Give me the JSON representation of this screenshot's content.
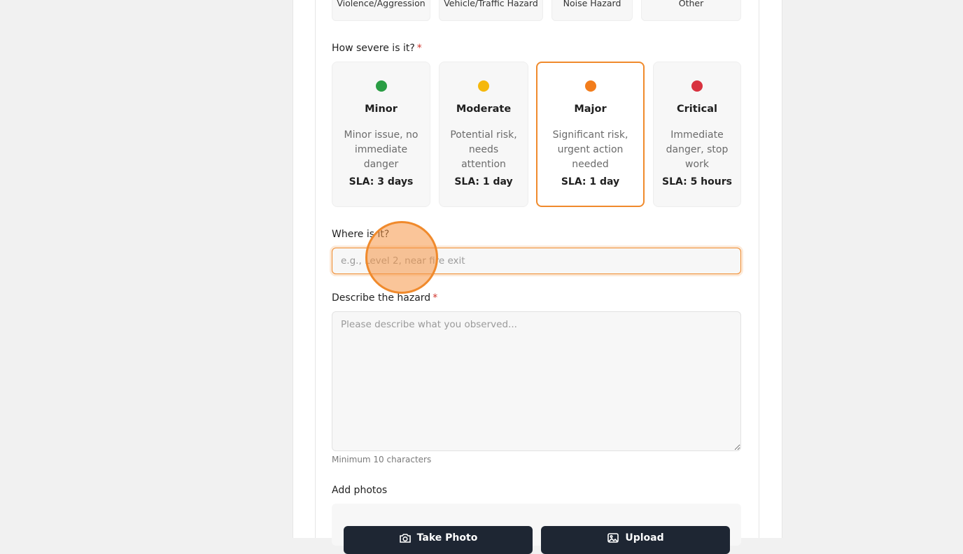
{
  "categories": [
    {
      "label": "Violence/Aggression"
    },
    {
      "label": "Vehicle/Traffic Hazard"
    },
    {
      "label": "Noise Hazard"
    },
    {
      "label": "Other"
    }
  ],
  "severity": {
    "label": "How severe is it?",
    "required_mark": "*",
    "options": [
      {
        "title": "Minor",
        "description": "Minor issue, no immediate danger",
        "sla": "SLA: 3 days",
        "color": "#2a9d44"
      },
      {
        "title": "Moderate",
        "description": "Potential risk, needs attention",
        "sla": "SLA: 1 day",
        "color": "#f5b80c"
      },
      {
        "title": "Major",
        "description": "Significant risk, urgent action needed",
        "sla": "SLA: 1 day",
        "color": "#f27d1c",
        "selected": true
      },
      {
        "title": "Critical",
        "description": "Immediate danger, stop work",
        "sla": "SLA: 5 hours",
        "color": "#d8323f"
      }
    ]
  },
  "location": {
    "label": "Where is it?",
    "placeholder": "e.g., Level 2, near fire exit",
    "value": ""
  },
  "description": {
    "label": "Describe the hazard",
    "required_mark": "*",
    "placeholder": "Please describe what you observed...",
    "value": "",
    "hint": "Minimum 10 characters"
  },
  "photos": {
    "label": "Add photos",
    "take_photo_label": "Take Photo",
    "upload_label": "Upload",
    "take_photo_icon": "camera-icon",
    "upload_icon": "image-icon"
  },
  "colors": {
    "accent": "#f08a2c",
    "button_dark": "#1e2633"
  }
}
